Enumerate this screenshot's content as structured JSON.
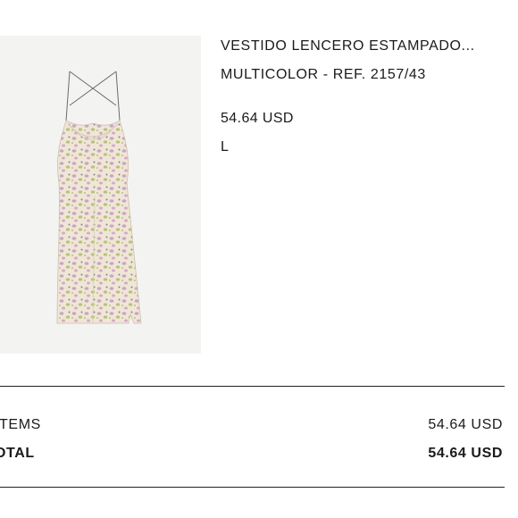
{
  "product": {
    "name": "VESTIDO LENCERO ESTAMPADO...",
    "color_ref": "MULTICOLOR - REF. 2157/43",
    "price": "54.64 USD",
    "size": "L",
    "image_icon": "printed-slip-dress-image"
  },
  "summary": {
    "items_label": "ITEMS",
    "items_value": "54.64 USD",
    "total_label": "OTAL",
    "total_value": "54.64 USD"
  },
  "colors": {
    "text": "#1a1a1a",
    "image_bg": "#f3f3f2",
    "divider": "#222222"
  }
}
